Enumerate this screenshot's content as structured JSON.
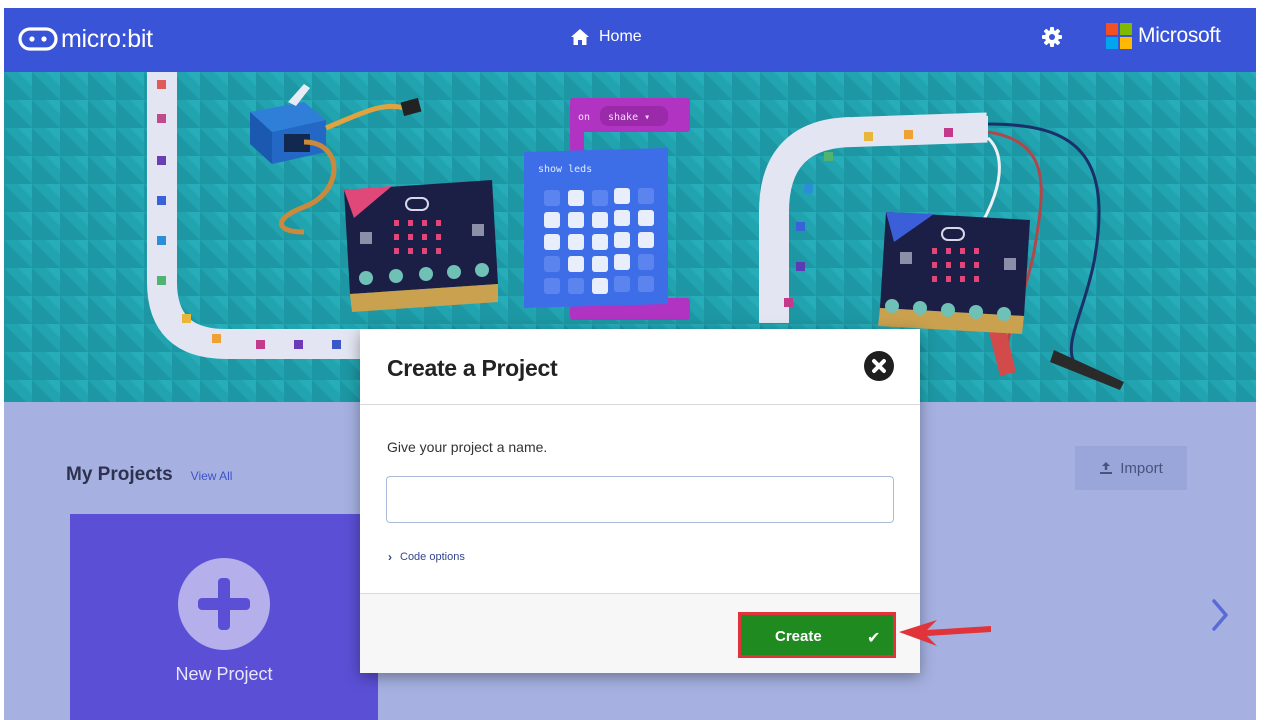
{
  "topbar": {
    "brand": "micro:bit",
    "home_label": "Home",
    "microsoft_label": "Microsoft",
    "colors": {
      "background": "#3954d6"
    },
    "icons": [
      "microbit-logo-icon",
      "home-icon",
      "gear-icon",
      "microsoft-logo-icon"
    ]
  },
  "hero": {
    "block_event": "on",
    "block_gesture": "shake ▾",
    "block_show": "show leds"
  },
  "projects": {
    "title": "My Projects",
    "view_all": "View All",
    "new_project_label": "New Project",
    "import_label": "Import"
  },
  "modal": {
    "title": "Create a Project",
    "prompt": "Give your project a name.",
    "input_value": "",
    "input_placeholder": "",
    "code_options_label": "Code options",
    "create_label": "Create",
    "create_icon": "checkmark-icon",
    "colors": {
      "create_button": "#1f8a1f",
      "highlight": "#e1343a"
    }
  }
}
